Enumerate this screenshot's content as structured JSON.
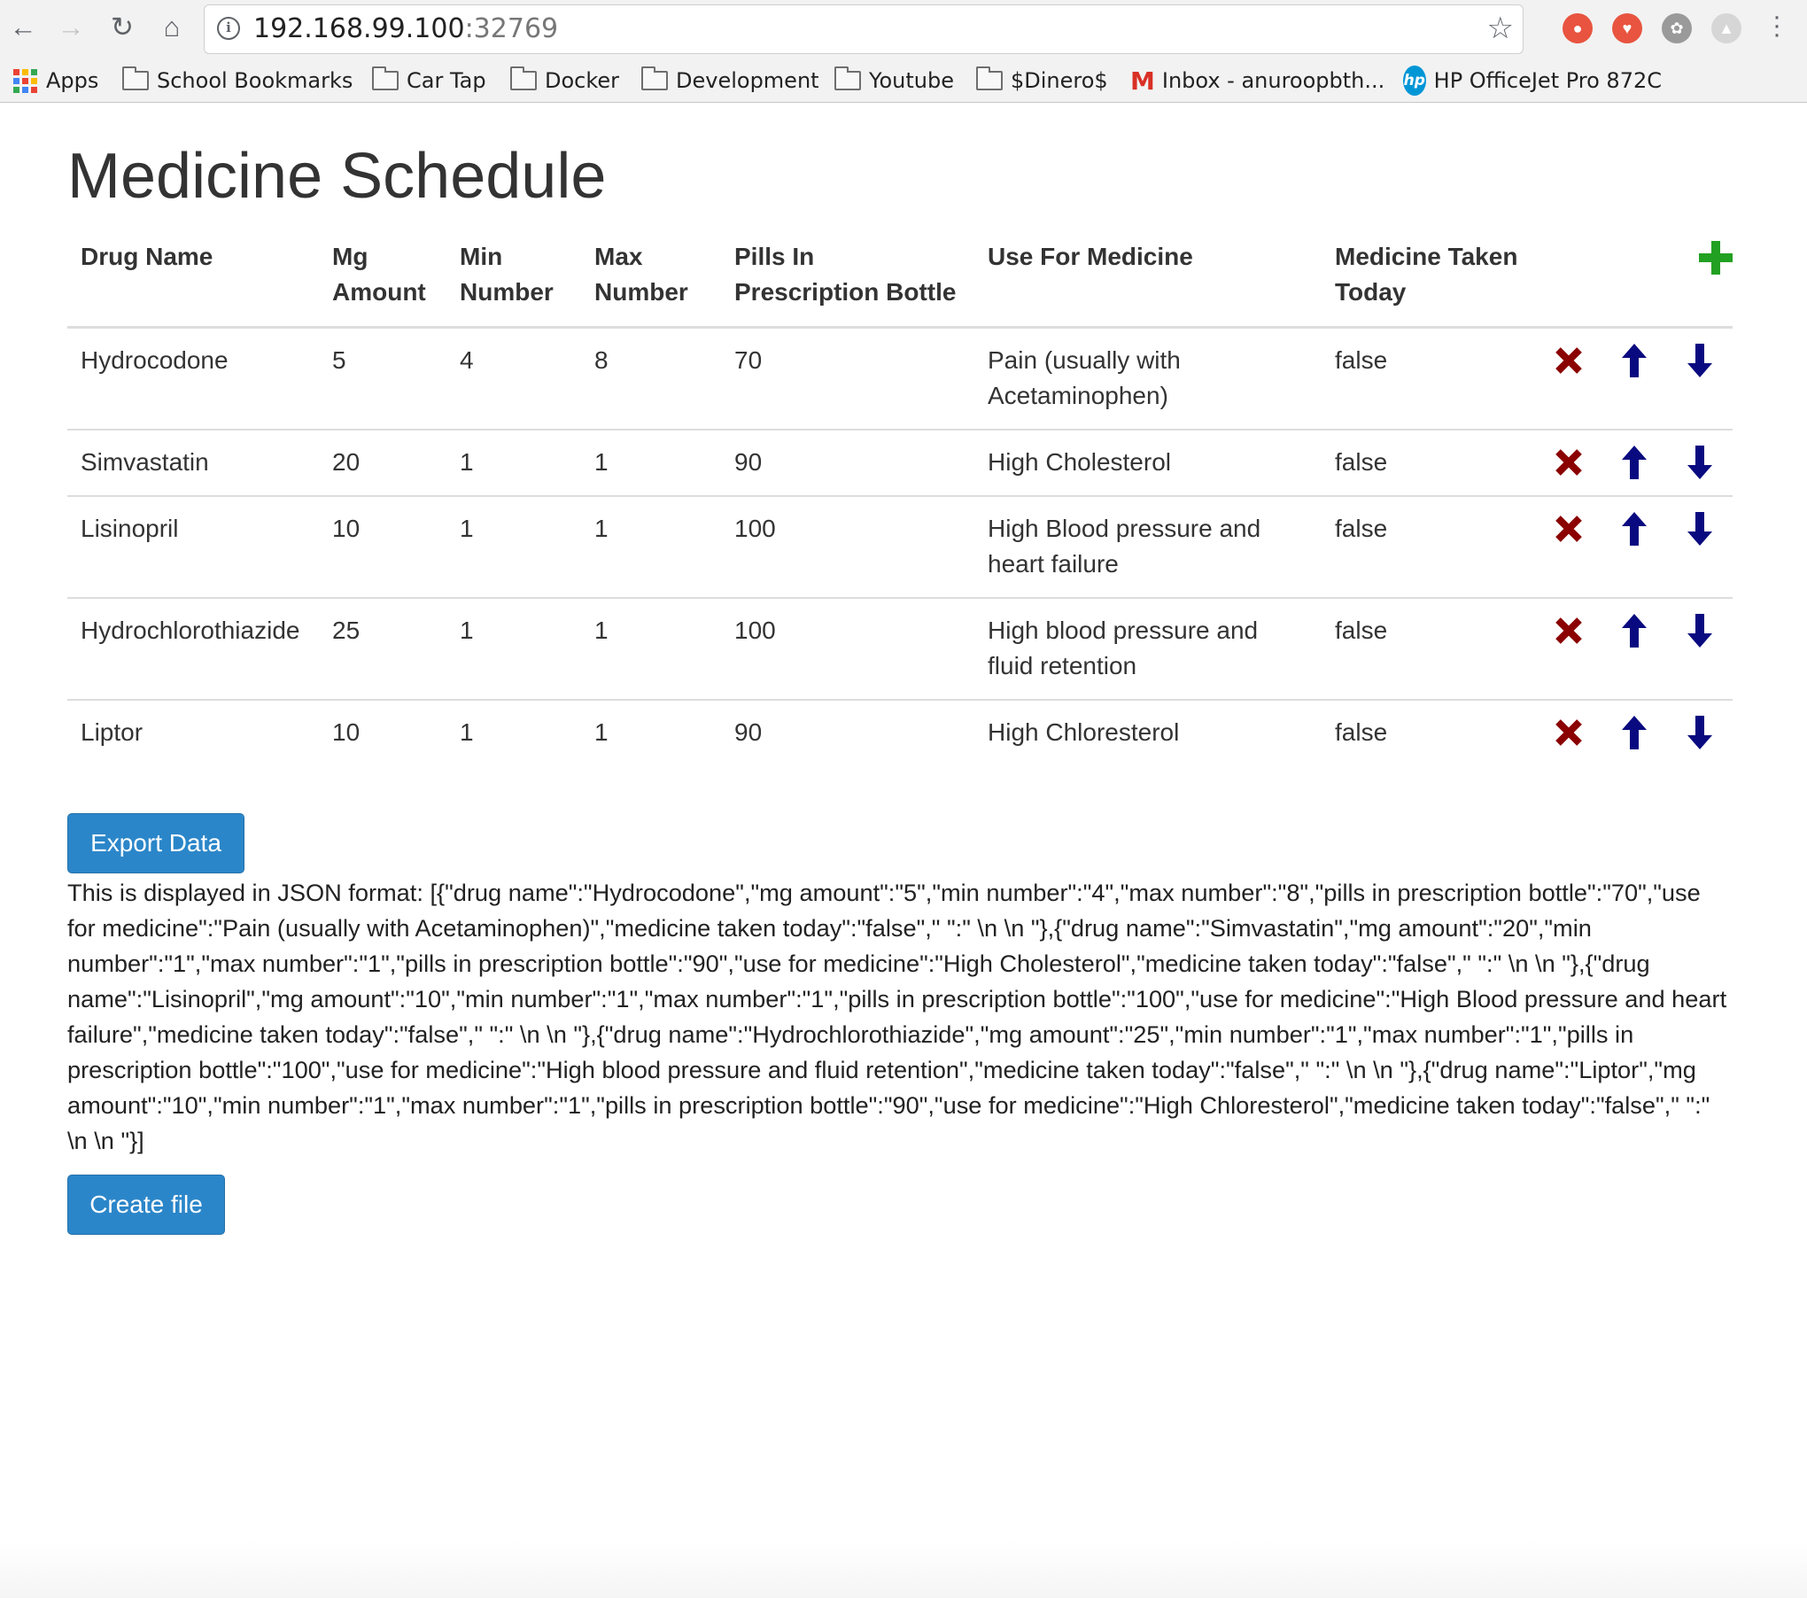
{
  "browser": {
    "url_host": "192.168.99.100",
    "url_port": ":32769",
    "bookmarks": [
      {
        "label": "Apps",
        "icon": "apps-grid-icon"
      },
      {
        "label": "School Bookmarks",
        "icon": "folder-icon"
      },
      {
        "label": "Car Tap",
        "icon": "folder-icon"
      },
      {
        "label": "Docker",
        "icon": "folder-icon"
      },
      {
        "label": "Development",
        "icon": "folder-icon"
      },
      {
        "label": "Youtube",
        "icon": "folder-icon"
      },
      {
        "label": "$Dinero$",
        "icon": "folder-icon"
      },
      {
        "label": "Inbox - anuroopbth...",
        "icon": "gmail-icon"
      },
      {
        "label": "HP OfficeJet Pro 872C",
        "icon": "hp-icon"
      }
    ],
    "extension_colors": [
      "#e8543f",
      "#e8543f",
      "#9a9a9a",
      "#c9c9c9"
    ]
  },
  "page": {
    "title": "Medicine Schedule",
    "columns": [
      "Drug Name",
      "Mg Amount",
      "Min Number",
      "Max Number",
      "Pills In Prescription Bottle",
      "Use For Medicine",
      "Medicine Taken Today"
    ],
    "rows": [
      {
        "drug": "Hydrocodone",
        "mg": "5",
        "min": "4",
        "max": "8",
        "pills": "70",
        "use": "Pain (usually with Acetaminophen)",
        "taken": "false"
      },
      {
        "drug": "Simvastatin",
        "mg": "20",
        "min": "1",
        "max": "1",
        "pills": "90",
        "use": "High Cholesterol",
        "taken": "false"
      },
      {
        "drug": "Lisinopril",
        "mg": "10",
        "min": "1",
        "max": "1",
        "pills": "100",
        "use": "High Blood pressure and heart failure",
        "taken": "false"
      },
      {
        "drug": "Hydrochlorothiazide",
        "mg": "25",
        "min": "1",
        "max": "1",
        "pills": "100",
        "use": "High blood pressure and fluid retention",
        "taken": "false"
      },
      {
        "drug": "Liptor",
        "mg": "10",
        "min": "1",
        "max": "1",
        "pills": "90",
        "use": "High Chloresterol",
        "taken": "false"
      }
    ],
    "export_button": "Export Data",
    "json_output": "This is displayed in JSON format: [{\"drug name\":\"Hydrocodone\",\"mg amount\":\"5\",\"min number\":\"4\",\"max number\":\"8\",\"pills in prescription bottle\":\"70\",\"use for medicine\":\"Pain (usually with Acetaminophen)\",\"medicine taken today\":\"false\",\" \":\" \\n \\n \"},{\"drug name\":\"Simvastatin\",\"mg amount\":\"20\",\"min number\":\"1\",\"max number\":\"1\",\"pills in prescription bottle\":\"90\",\"use for medicine\":\"High Cholesterol\",\"medicine taken today\":\"false\",\" \":\" \\n \\n \"},{\"drug name\":\"Lisinopril\",\"mg amount\":\"10\",\"min number\":\"1\",\"max number\":\"1\",\"pills in prescription bottle\":\"100\",\"use for medicine\":\"High Blood pressure and heart failure\",\"medicine taken today\":\"false\",\" \":\" \\n \\n \"},{\"drug name\":\"Hydrochlorothiazide\",\"mg amount\":\"25\",\"min number\":\"1\",\"max number\":\"1\",\"pills in prescription bottle\":\"100\",\"use for medicine\":\"High blood pressure and fluid retention\",\"medicine taken today\":\"false\",\" \":\" \\n \\n \"},{\"drug name\":\"Liptor\",\"mg amount\":\"10\",\"min number\":\"1\",\"max number\":\"1\",\"pills in prescription bottle\":\"90\",\"use for medicine\":\"High Chloresterol\",\"medicine taken today\":\"false\",\" \":\" \\n \\n \"}]",
    "create_button": "Create file"
  },
  "colors": {
    "delete": "#8b0000",
    "arrow": "#0a0a80",
    "add": "#22a022",
    "button": "#2b86c9"
  }
}
